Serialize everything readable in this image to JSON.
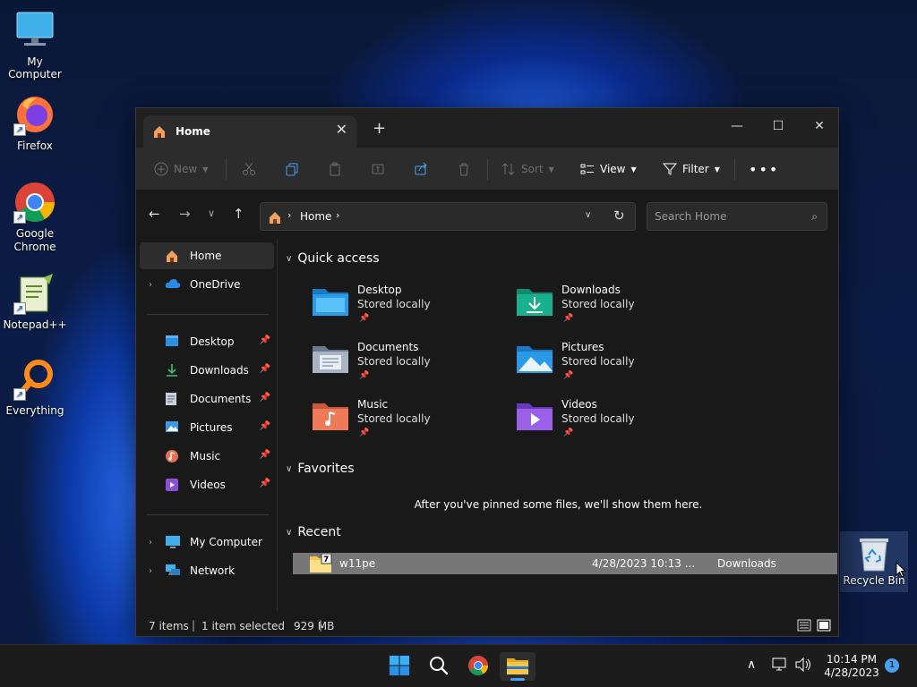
{
  "desktop": {
    "icons": [
      {
        "label": "My Computer"
      },
      {
        "label": "Firefox"
      },
      {
        "label": "Google Chrome"
      },
      {
        "label": "Notepad++"
      },
      {
        "label": "Everything"
      }
    ],
    "recycle_bin": "Recycle Bin"
  },
  "window": {
    "tab_title": "Home",
    "toolbar": {
      "new": "New",
      "sort": "Sort",
      "view": "View",
      "filter": "Filter"
    },
    "address": {
      "crumb": "Home",
      "search_placeholder": "Search Home"
    },
    "sidebar": {
      "top": [
        {
          "label": "Home"
        },
        {
          "label": "OneDrive"
        }
      ],
      "pinned": [
        {
          "label": "Desktop"
        },
        {
          "label": "Downloads"
        },
        {
          "label": "Documents"
        },
        {
          "label": "Pictures"
        },
        {
          "label": "Music"
        },
        {
          "label": "Videos"
        }
      ],
      "bottom": [
        {
          "label": "My Computer"
        },
        {
          "label": "Network"
        }
      ]
    },
    "quick_access": {
      "heading": "Quick access",
      "items": [
        {
          "name": "Desktop",
          "sub": "Stored locally"
        },
        {
          "name": "Downloads",
          "sub": "Stored locally"
        },
        {
          "name": "Documents",
          "sub": "Stored locally"
        },
        {
          "name": "Pictures",
          "sub": "Stored locally"
        },
        {
          "name": "Music",
          "sub": "Stored locally"
        },
        {
          "name": "Videos",
          "sub": "Stored locally"
        }
      ]
    },
    "favorites": {
      "heading": "Favorites",
      "empty": "After you've pinned some files, we'll show them here."
    },
    "recent": {
      "heading": "Recent",
      "rows": [
        {
          "name": "w11pe",
          "date": "4/28/2023 10:13 ...",
          "location": "Downloads"
        }
      ]
    },
    "status": {
      "items": "7 items",
      "selected": "1 item selected",
      "size": "929 MB"
    }
  },
  "taskbar": {
    "time": "10:14 PM",
    "date": "4/28/2023",
    "notifications": "1"
  },
  "colors": {
    "accent": "#4aa0f0",
    "folder_yellow": "#f3c64b",
    "window_bg": "#191919",
    "toolbar_bg": "#2c2c2c"
  }
}
